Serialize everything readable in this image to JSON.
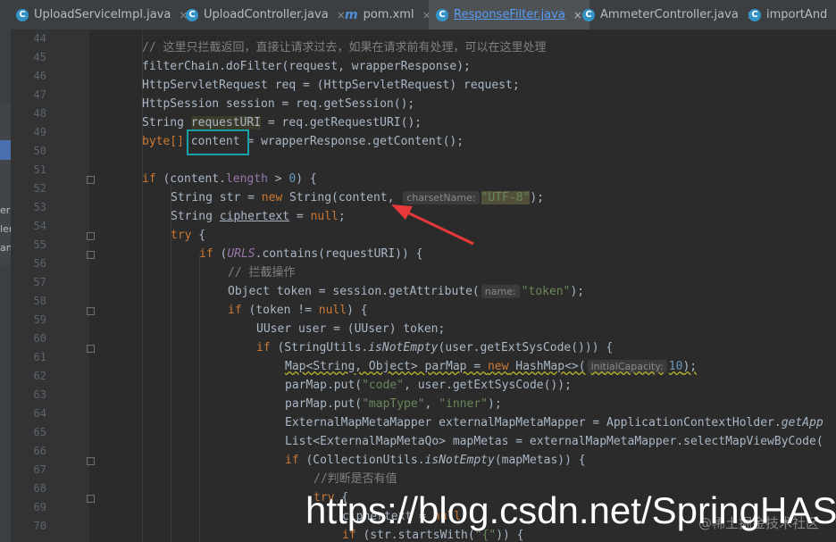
{
  "tabs": [
    {
      "label": "UploadServiceImpl.java",
      "icon": "class-icon",
      "active": false
    },
    {
      "label": "UploadController.java",
      "icon": "class-icon",
      "active": false
    },
    {
      "label": "pom.xml",
      "icon": "maven-icon",
      "active": false
    },
    {
      "label": "ResponseFilter.java",
      "icon": "class-icon",
      "active": true
    },
    {
      "label": "AmmeterController.java",
      "icon": "class-icon",
      "active": false
    },
    {
      "label": "importAnd",
      "icon": "class-icon",
      "active": false
    }
  ],
  "tab_close_glyph": "×",
  "icons": {
    "class_glyph": "C",
    "maven_glyph": "m"
  },
  "left_strip_text": [
    "er",
    "ler",
    "an"
  ],
  "line_numbers": [
    "44",
    "45",
    "46",
    "47",
    "48",
    "49",
    "50",
    "51",
    "52",
    "53",
    "54",
    "55",
    "56",
    "57",
    "58",
    "59",
    "60",
    "61",
    "62",
    "63",
    "64",
    "65",
    "66",
    "67",
    "68",
    "69",
    "70"
  ],
  "code": {
    "l44": "// 这里只拦截返回，直接让请求过去，如果在请求前有处理，可以在这里处理",
    "l45": "filterChain.doFilter(request, wrapperResponse);",
    "l46": "HttpServletRequest req = (HttpServletRequest) request;",
    "l47": "HttpSession session = req.getSession();",
    "l48_a": "String ",
    "l48_b": "requestURI",
    "l48_c": " = req.getRequestURI();",
    "l49_a": "byte[] ",
    "l49_b": "content",
    "l49_c": " = wrapperResponse.getContent();",
    "l51_kw": "if",
    "l51_a": " (content.",
    "l51_fld": "length",
    "l51_b": " > ",
    "l51_num": "0",
    "l51_c": ") {",
    "l52_a": "String str = ",
    "l52_kw": "new",
    "l52_b": " String(content, ",
    "l52_hint": "charsetName:",
    "l52_str": "\"UTF-8\"",
    "l52_c": ");",
    "l53_a": "String ",
    "l53_b": "ciphertext",
    "l53_c": " = ",
    "l53_kw": "null",
    "l53_d": ";",
    "l54_kw": "try",
    "l54_a": " {",
    "l55_kw": "if",
    "l55_a": " (",
    "l55_fld": "URLS",
    "l55_b": ".contains(requestURI)) {",
    "l56": "// 拦截操作",
    "l57_a": "Object token = session.getAttribute(",
    "l57_hint": "name:",
    "l57_str": "\"token\"",
    "l57_b": ");",
    "l58_kw": "if",
    "l58_a": " (token != ",
    "l58_kw2": "null",
    "l58_b": ") {",
    "l59": "UUser user = (UUser) token;",
    "l60_kw": "if",
    "l60_a": " (StringUtils.",
    "l60_it": "isNotEmpty",
    "l60_b": "(user.getExtSysCode())) {",
    "l61_a": "Map<String, Object> parMap = ",
    "l61_kw": "new",
    "l61_b": " HashMap<>(",
    "l61_hint": "initialCapacity:",
    "l61_num": "10",
    "l61_c": ");",
    "l62_a": "parMap.put(",
    "l62_str": "\"code\"",
    "l62_b": ", user.getExtSysCode());",
    "l63_a": "parMap.put(",
    "l63_str": "\"mapType\"",
    "l63_b": ", ",
    "l63_str2": "\"inner\"",
    "l63_c": ");",
    "l64_a": "ExternalMapMetaMapper externalMapMetaMapper = ApplicationContextHolder.",
    "l64_it": "getApp",
    "l65": "List<ExternalMapMetaQo> mapMetas = externalMapMetaMapper.selectMapViewByCode(",
    "l66_kw": "if",
    "l66_a": " (CollectionUtils.",
    "l66_it": "isNotEmpty",
    "l66_b": "(mapMetas)) {",
    "l67": "//判断是否有值",
    "l68_kw": "try",
    "l68_a": " {",
    "l69_a": "ciphertext = ",
    "l69_kw": "null",
    "l69_b": ";",
    "l70_kw": "if",
    "l70_a": " (str.startsWith(",
    "l70_str": "\"{\"",
    "l70_b": ")) {"
  },
  "watermark": "https://blog.csdn.net/SpringHASh",
  "juejin_mark": "@稀土掘金技术社区",
  "colors": {
    "keyword": "#cc7832",
    "string": "#6a8759",
    "number": "#6897bb",
    "field": "#9876aa",
    "comment": "#808080",
    "highlight_box": "#14a0a8",
    "arrow": "#e8393a"
  }
}
